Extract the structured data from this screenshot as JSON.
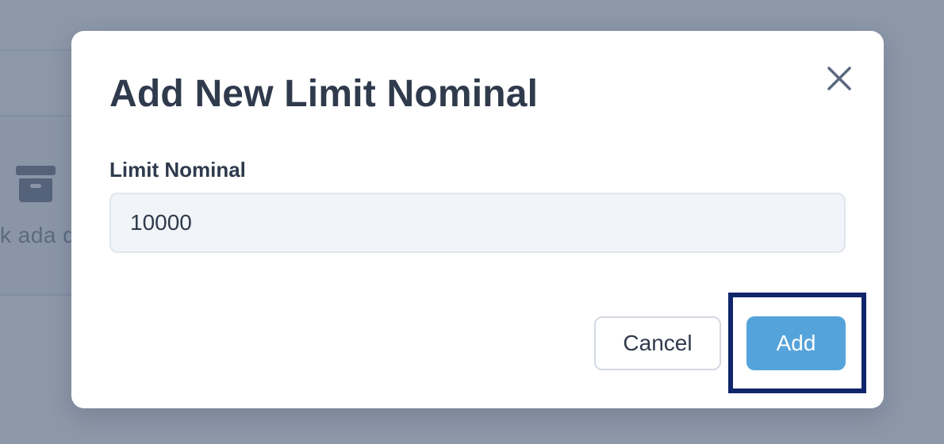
{
  "background": {
    "empty_state_text": "k ada d",
    "empty_state_icon": "archive-icon"
  },
  "modal": {
    "title": "Add New Limit Nominal",
    "close_icon": "close-icon",
    "field": {
      "label": "Limit Nominal",
      "value": "10000"
    },
    "buttons": {
      "cancel_label": "Cancel",
      "add_label": "Add"
    },
    "colors": {
      "primary": "#54a3db",
      "highlight": "#10266b",
      "text": "#2f3a4c"
    }
  }
}
